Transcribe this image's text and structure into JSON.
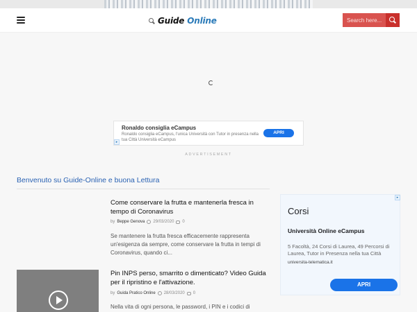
{
  "header": {
    "logo_text_main": "Guide ",
    "logo_text_accent": "Online",
    "search_placeholder": "Search here...",
    "search_icon": "search-icon",
    "menu_icon": "hamburger-icon"
  },
  "top_ad": {
    "title": "Ronaldo consiglia eCampus",
    "description": "Ronaldo consiglia eCampus, l'unica Università con Tutor in presenza nella tua Città Università eCampus",
    "cta": "APRI"
  },
  "ad_label": "ADVERTISEMENT",
  "welcome": "Benvenuto su Guide-Online e buona Lettura",
  "posts": [
    {
      "title": "Come conservare la frutta e mantenerla fresca in tempo di Coronavirus",
      "by": "by",
      "author": "Beppe Genova",
      "date": "29/03/2020",
      "comments": "0",
      "excerpt": "Se mantenere la frutta fresca efficacemente rappresenta un'esigenza da sempre, come conservare la frutta in tempi di Coronavirus, quando ci..."
    },
    {
      "title": "Pin INPS perso, smarrito o dimenticato? Video Guida per il ripristino e l'attivazione.",
      "by": "by",
      "author": "Guida Pratico Online",
      "date": "28/03/2020",
      "comments": "0",
      "excerpt": "Nella vita di ogni persona, le password, i PIN e i codici di"
    }
  ],
  "side_ad": {
    "brand": "Corsi",
    "headline": "Università Online eCampus",
    "body": "5 Facoltà, 24 Corsi di Laurea, 49 Percorsi di Laurea, Tutor in Presenza nella tua Città",
    "url": "universita-telematica.it",
    "cta": "APRI"
  },
  "colors": {
    "accent_blue": "#2a62b3",
    "search_red": "#d9534f",
    "cta_blue": "#1a73e8"
  }
}
